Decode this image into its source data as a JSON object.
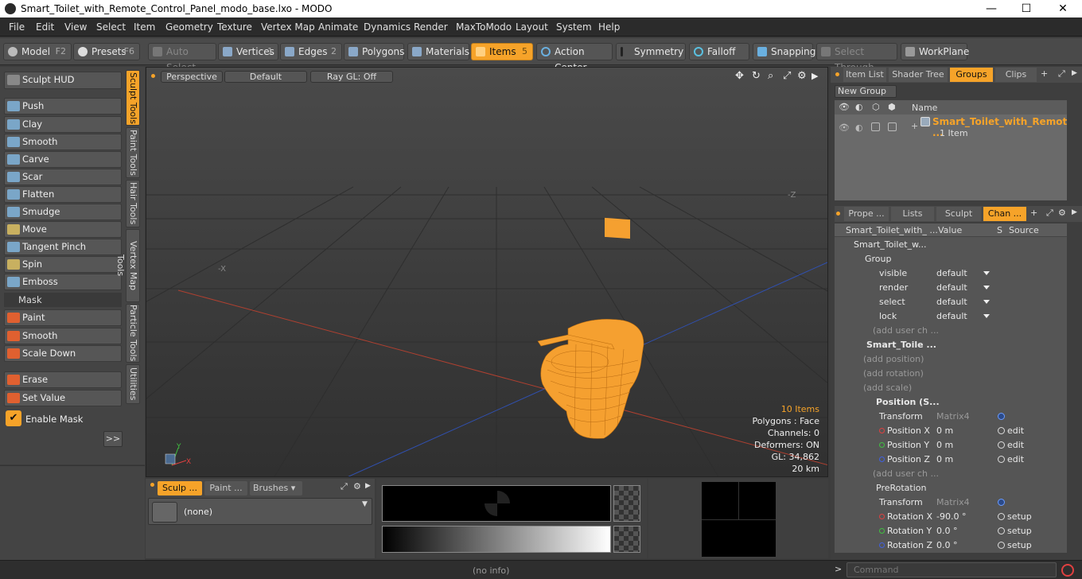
{
  "window": {
    "title": "Smart_Toilet_with_Remote_Control_Panel_modo_base.lxo - MODO",
    "min": "—",
    "max": "☐",
    "close": "✕"
  },
  "menu": [
    "File",
    "Edit",
    "View",
    "Select",
    "Item",
    "Geometry",
    "Texture",
    "Vertex Map",
    "Animate",
    "Dynamics",
    "Render",
    "MaxToModo",
    "Layout",
    "System",
    "Help"
  ],
  "toolbar": {
    "model": "Model",
    "model_key": "F2",
    "presets": "Presets",
    "presets_key": "F6",
    "auto_select": "Auto Select",
    "vertices": "Vertices",
    "vertices_key": "1",
    "edges": "Edges",
    "edges_key": "2",
    "polygons": "Polygons",
    "materials": "Materials",
    "items": "Items",
    "items_key": "5",
    "action_center": "Action Center",
    "symmetry": "Symmetry",
    "falloff": "Falloff",
    "snapping": "Snapping",
    "select_through": "Select Through",
    "workplane": "WorkPlane"
  },
  "sculpt": {
    "hud": "Sculpt HUD",
    "tools": [
      "Push",
      "Clay",
      "Smooth",
      "Carve",
      "Scar",
      "Flatten",
      "Smudge",
      "Move",
      "Tangent Pinch",
      "Spin",
      "Emboss"
    ],
    "mask_header": "Mask",
    "mask_tools": [
      "Paint",
      "Smooth",
      "Scale Down"
    ],
    "erase": "Erase",
    "set_value": "Set Value",
    "enable_mask": "Enable Mask",
    "more": ">>"
  },
  "vtabs": [
    "Sculpt Tools",
    "Paint Tools",
    "Hair Tools",
    "Vertex Map Tools",
    "Particle Tools",
    "Utilities"
  ],
  "viewport": {
    "perspective": "Perspective",
    "default": "Default",
    "raygl": "Ray GL: Off",
    "axis_neg_z": "-Z",
    "axis_neg_x": "-X",
    "stats": {
      "items": "10 Items",
      "polygons": "Polygons : Face",
      "channels": "Channels: 0",
      "deformers": "Deformers: ON",
      "gl": "GL: 34,862",
      "dist": "20 km"
    }
  },
  "bottom_left": {
    "tabs": [
      "Sculp ...",
      "Paint ...",
      "Brushes"
    ],
    "preset": "(none)"
  },
  "status": {
    "info": "(no info)",
    "command_placeholder": "Command"
  },
  "right": {
    "top_tabs": [
      "Item List",
      "Shader Tree",
      "Groups",
      "Clips"
    ],
    "new_group": "New Group",
    "name_header": "Name",
    "group_name": "Smart_Toilet_with_Remot ...",
    "group_count": "1 Item",
    "mid_tabs": [
      "Prope ...",
      "Lists",
      "Sculpt",
      "Chan ..."
    ],
    "chan_headers": {
      "name": "Smart_Toilet_with_ ...",
      "value": "Value",
      "s": "S",
      "source": "Source"
    },
    "rows": [
      {
        "name": "Smart_Toilet_w...",
        "value": "",
        "src": "",
        "indent": 24
      },
      {
        "name": "Group",
        "value": "",
        "src": "",
        "indent": 38
      },
      {
        "name": "visible",
        "value": "default",
        "src": "",
        "indent": 56,
        "dd": true
      },
      {
        "name": "render",
        "value": "default",
        "src": "",
        "indent": 56,
        "dd": true
      },
      {
        "name": "select",
        "value": "default",
        "src": "",
        "indent": 56,
        "dd": true
      },
      {
        "name": "lock",
        "value": "default",
        "src": "",
        "indent": 56,
        "dd": true
      },
      {
        "name": "(add user ch ...",
        "value": "",
        "src": "",
        "indent": 48,
        "dim": true
      },
      {
        "name": "Smart_Toile ...",
        "value": "",
        "src": "",
        "indent": 40,
        "bold": true
      },
      {
        "name": "(add position)",
        "value": "",
        "src": "",
        "indent": 36,
        "dim": true
      },
      {
        "name": "(add rotation)",
        "value": "",
        "src": "",
        "indent": 36,
        "dim": true
      },
      {
        "name": "(add scale)",
        "value": "",
        "src": "",
        "indent": 36,
        "dim": true
      },
      {
        "name": "Position (S...",
        "value": "",
        "src": "",
        "indent": 52,
        "bold": true
      },
      {
        "name": "Transform",
        "value": "Matrix4",
        "src": "",
        "indent": 56,
        "dimv": true
      },
      {
        "name": "Position X",
        "value": "0 m",
        "src": "edit",
        "indent": 56,
        "dot": "#e04040"
      },
      {
        "name": "Position Y",
        "value": "0 m",
        "src": "edit",
        "indent": 56,
        "dot": "#40c040"
      },
      {
        "name": "Position Z",
        "value": "0 m",
        "src": "edit",
        "indent": 56,
        "dot": "#4060e0"
      },
      {
        "name": "(add user ch ...",
        "value": "",
        "src": "",
        "indent": 48,
        "dim": true
      },
      {
        "name": "PreRotation",
        "value": "",
        "src": "",
        "indent": 52
      },
      {
        "name": "Transform",
        "value": "Matrix4",
        "src": "",
        "indent": 56,
        "dimv": true
      },
      {
        "name": "Rotation X",
        "value": "-90.0 °",
        "src": "setup",
        "indent": 56,
        "dot": "#e04040"
      },
      {
        "name": "Rotation Y",
        "value": "0.0 °",
        "src": "setup",
        "indent": 56,
        "dot": "#40c040"
      },
      {
        "name": "Rotation Z",
        "value": "0.0 °",
        "src": "setup",
        "indent": 56,
        "dot": "#4060e0"
      }
    ]
  },
  "colors": {
    "accent": "#f6a329",
    "mesh": "#f5a030"
  }
}
